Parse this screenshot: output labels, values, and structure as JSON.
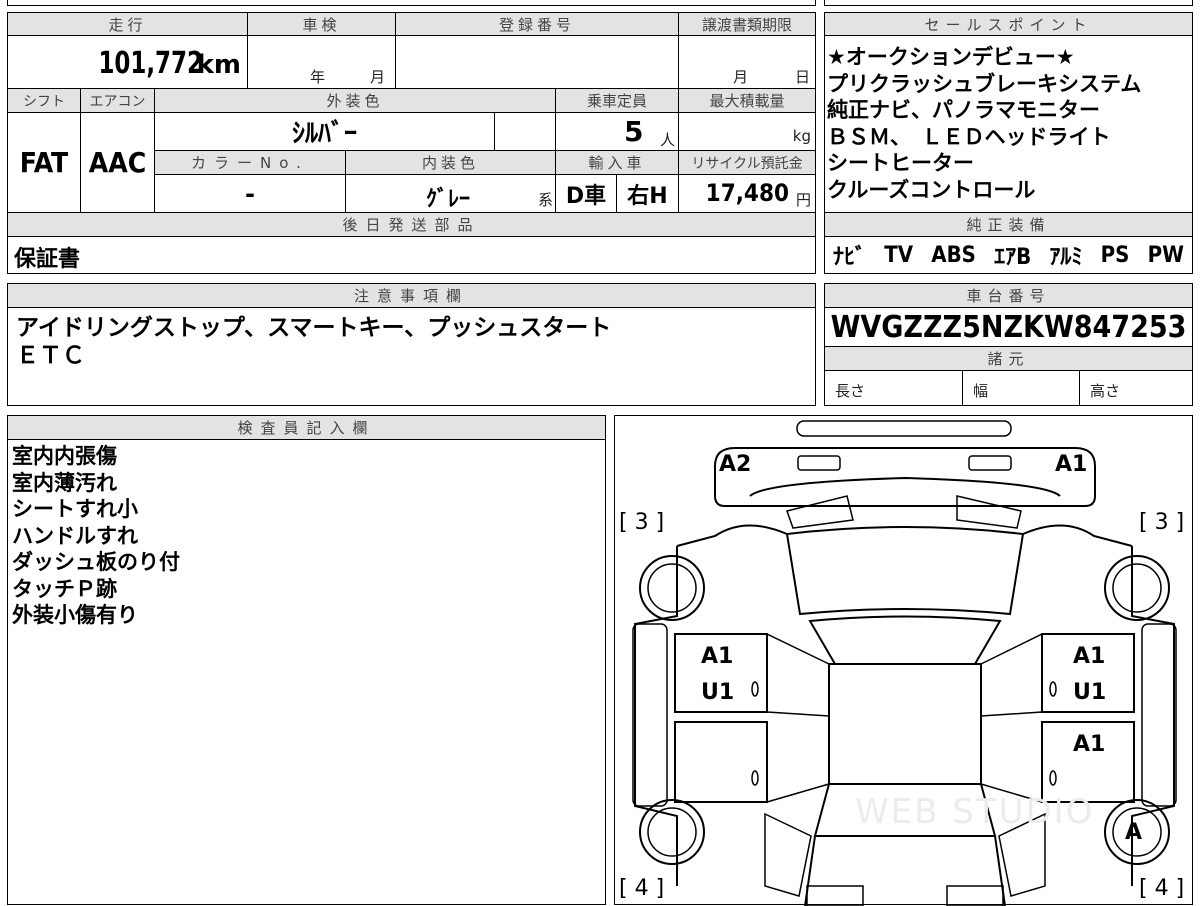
{
  "vehicle": {
    "mileage_label": "走行",
    "mileage_value": "101,772",
    "mileage_unit": "km",
    "inspection_label": "車検",
    "inspection_year_unit": "年",
    "inspection_month_unit": "月",
    "registration_label": "登録番号",
    "registration_value": "",
    "transfer_label": "譲渡書類期限",
    "transfer_month_unit": "月",
    "transfer_day_unit": "日",
    "shift_label": "シフト",
    "shift_value": "FAT",
    "aircon_label": "エアコン",
    "aircon_value": "AAC",
    "exterior_label": "外装色",
    "exterior_value": "ｼﾙﾊﾞｰ",
    "capacity_label": "乗車定員",
    "capacity_value": "5",
    "capacity_unit": "人",
    "maxload_label": "最大積載量",
    "maxload_unit": "kg",
    "color_no_label": "カラーNo.",
    "color_no_value": "-",
    "interior_label": "内装色",
    "interior_value": "ｸﾞﾚｰ",
    "interior_suffix": "系",
    "import_label": "輸入車",
    "import_dealer": "D車",
    "import_handle": "右H",
    "recycle_label": "リサイクル預託金",
    "recycle_value": "17,480",
    "recycle_unit": "円"
  },
  "later_parts": {
    "label": "後日発送部品",
    "value": "保証書"
  },
  "notes": {
    "label": "注意事項欄",
    "line1": "アイドリングストップ、スマートキー、プッシュスタート",
    "line2": "ＥＴＣ"
  },
  "inspector": {
    "label": "検査員記入欄",
    "items": [
      "室内内張傷",
      "室内薄汚れ",
      "シートすれ小",
      "ハンドルすれ",
      "ダッシュ板のり付",
      "タッチＰ跡",
      "外装小傷有り"
    ]
  },
  "sales": {
    "label": "セールスポイント",
    "lines": [
      "★オークションデビュー★",
      "プリクラッシュブレーキシステム",
      "純正ナビ、パノラマモニター",
      "ＢＳＭ、　ＬＥＤヘッドライト",
      "シートヒーター",
      "クルーズコントロール"
    ]
  },
  "equipment": {
    "label": "純正装備",
    "items": [
      "ﾅﾋﾞ",
      "TV",
      "ABS",
      "ｴｱB",
      "ｱﾙﾐ",
      "PS",
      "PW"
    ]
  },
  "chassis": {
    "label": "車台番号",
    "value": "WVGZZZ5NZKW847253"
  },
  "specs": {
    "label": "諸元",
    "length_label": "長さ",
    "width_label": "幅",
    "height_label": "高さ"
  },
  "diagram": {
    "front_left": "A2",
    "front_right": "A1",
    "tire_fl": "[ 3 ]",
    "tire_fr": "[ 3 ]",
    "tire_rl": "[ 4 ]",
    "tire_rr": "[ 4 ]",
    "left_door_front_1": "A1",
    "left_door_front_2": "U1",
    "right_door_front_1": "A1",
    "right_door_front_2": "U1",
    "right_door_rear": "A1",
    "rear_right_wheel": "A",
    "watermark": "WEB STUDIO"
  }
}
